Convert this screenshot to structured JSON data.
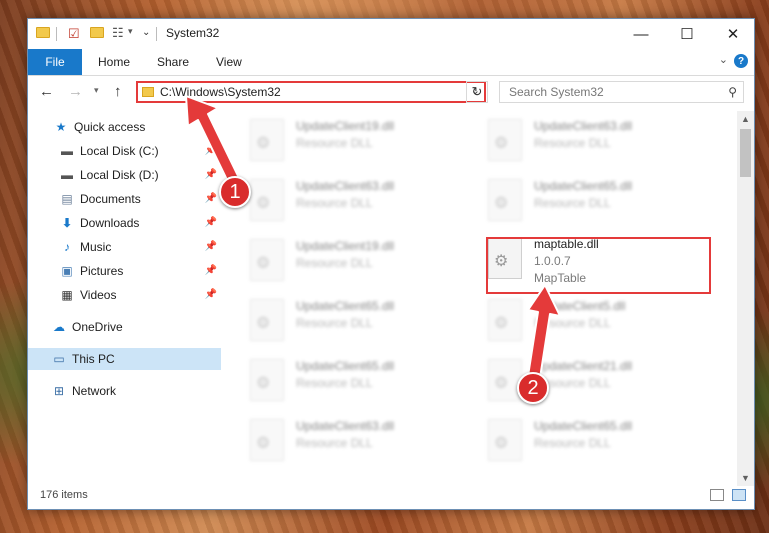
{
  "window": {
    "title": "System32",
    "controls": {
      "minimize": "—",
      "maximize": "☐",
      "close": "✕"
    }
  },
  "ribbon": {
    "file_tab": "File",
    "tabs": [
      "Home",
      "Share",
      "View"
    ],
    "help": "?"
  },
  "address": {
    "path": "C:\\Windows\\System32",
    "search_placeholder": "Search System32"
  },
  "nav": {
    "items": [
      {
        "label": "Quick access",
        "icon": "star-icon",
        "pinned": false
      },
      {
        "label": "Local Disk (C:)",
        "icon": "drive-icon",
        "pinned": true
      },
      {
        "label": "Local Disk (D:)",
        "icon": "drive-icon",
        "pinned": true
      },
      {
        "label": "Documents",
        "icon": "documents-icon",
        "pinned": true
      },
      {
        "label": "Downloads",
        "icon": "downloads-icon",
        "pinned": true
      },
      {
        "label": "Music",
        "icon": "music-icon",
        "pinned": true
      },
      {
        "label": "Pictures",
        "icon": "pictures-icon",
        "pinned": true
      },
      {
        "label": "Videos",
        "icon": "videos-icon",
        "pinned": true
      },
      {
        "label": "OneDrive",
        "icon": "cloud-icon",
        "pinned": false
      },
      {
        "label": "This PC",
        "icon": "computer-icon",
        "pinned": false,
        "selected": true
      },
      {
        "label": "Network",
        "icon": "network-icon",
        "pinned": false
      }
    ]
  },
  "files": [
    {
      "name": "UpdateClient19.dll",
      "desc": "Resource DLL",
      "blurred": true
    },
    {
      "name": "UpdateClient63.dll",
      "desc": "Resource DLL",
      "blurred": true
    },
    {
      "name": "UpdateClient63.dll",
      "desc": "Resource DLL",
      "blurred": true
    },
    {
      "name": "UpdateClient65.dll",
      "desc": "Resource DLL",
      "blurred": true
    },
    {
      "name": "UpdateClient19.dll",
      "desc": "Resource DLL",
      "blurred": true
    },
    {
      "name": "maptable.dll",
      "version": "1.0.0.7",
      "desc": "MapTable",
      "blurred": false
    },
    {
      "name": "UpdateClient65.dll",
      "desc": "Resource DLL",
      "blurred": true
    },
    {
      "name": "UpdateClient5.dll",
      "desc": "Resource DLL",
      "blurred": true
    },
    {
      "name": "UpdateClient65.dll",
      "desc": "Resource DLL",
      "blurred": true
    },
    {
      "name": "UpdateClient21.dll",
      "desc": "Resource DLL",
      "blurred": true
    },
    {
      "name": "UpdateClient63.dll",
      "desc": "Resource DLL",
      "blurred": true
    },
    {
      "name": "UpdateClient65.dll",
      "desc": "Resource DLL",
      "blurred": true
    }
  ],
  "status": {
    "count": "176 items"
  },
  "annotations": {
    "step1": "1",
    "step2": "2"
  },
  "colors": {
    "accent": "#1979ca",
    "annotation": "#e43a3a"
  }
}
